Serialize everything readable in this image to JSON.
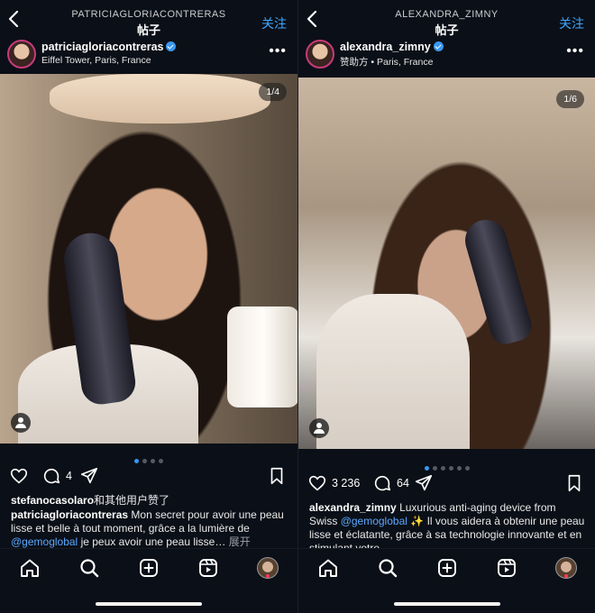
{
  "panes": [
    {
      "header": {
        "username": "PATRICIAGLORIACONTRERAS",
        "title": "帖子",
        "follow": "关注"
      },
      "author": {
        "name": "patriciagloriacontreras",
        "location": "Eiffel Tower, Paris, France"
      },
      "photo": {
        "counter": "1/4"
      },
      "carousel": {
        "total": 4,
        "active": 1
      },
      "actions": {
        "likes": "",
        "comments": "4"
      },
      "liked_by": {
        "user": "stefanocasolaro",
        "suffix": "和其他用户赞了"
      },
      "caption": {
        "user": "patriciagloriacontreras",
        "text": "Mon secret pour avoir une peau lisse et belle à tout moment, grâce a la lumière de",
        "mention": "@gemoglobal",
        "text2": "je peux avoir une peau lisse…",
        "more": "展开"
      }
    },
    {
      "header": {
        "username": "ALEXANDRA_ZIMNY",
        "title": "帖子",
        "follow": "关注"
      },
      "author": {
        "name": "alexandra_zimny",
        "location": "赞助方 • Paris, France"
      },
      "photo": {
        "counter": "1/6"
      },
      "carousel": {
        "total": 6,
        "active": 1
      },
      "actions": {
        "likes": "3 236",
        "comments": "64"
      },
      "caption": {
        "user": "alexandra_zimny",
        "text": "Luxurious anti-aging device from Swiss",
        "mention": "@gemoglobal",
        "emoji": "✨",
        "text2": "Il vous aidera à obtenir une peau lisse et éclatante, grâce à sa technologie innovante et en stimulant votre"
      }
    }
  ],
  "icons": {
    "back": "chevron-left-icon",
    "heart": "heart-icon",
    "comment": "comment-icon",
    "share": "paper-plane-icon",
    "bookmark": "bookmark-icon",
    "home": "home-icon",
    "search": "search-icon",
    "create": "plus-square-icon",
    "reels": "reels-icon"
  },
  "colors": {
    "accent": "#3ea6ff",
    "background": "#0b0f17",
    "verified": "#3897f0",
    "notification": "#ff3b5c"
  }
}
